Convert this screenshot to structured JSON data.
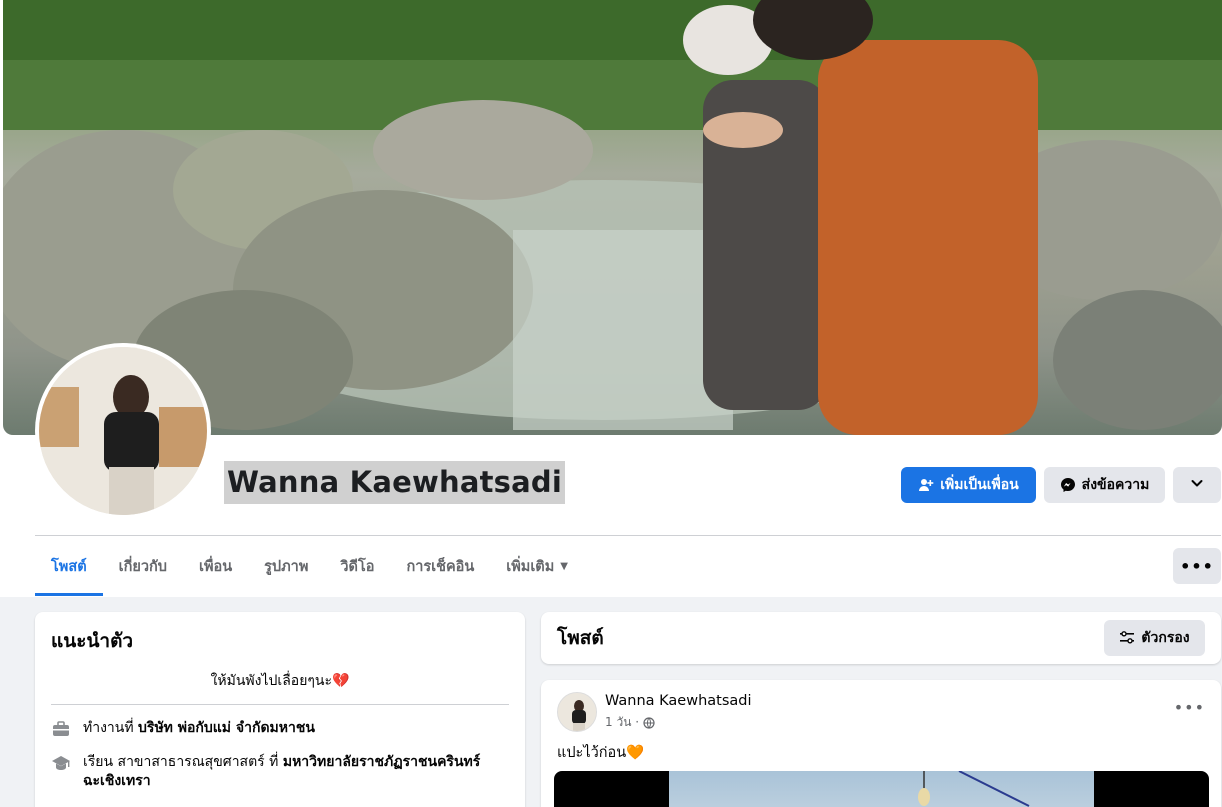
{
  "profile": {
    "name": "Wanna Kaewhatsadi",
    "add_friend_label": "เพิ่มเป็นเพื่อน",
    "message_label": "ส่งข้อความ"
  },
  "tabs": [
    {
      "label": "โพสต์",
      "active": true
    },
    {
      "label": "เกี่ยวกับ"
    },
    {
      "label": "เพื่อน"
    },
    {
      "label": "รูปภาพ"
    },
    {
      "label": "วิดีโอ"
    },
    {
      "label": "การเช็คอิน"
    },
    {
      "label": "เพิ่มเติม"
    }
  ],
  "intro": {
    "title": "แนะนำตัว",
    "bio": "ให้มันพังไปเลื่อยๆนะ💔",
    "work_prefix": "ทำงานที่",
    "work_place": "บริษัท พ่อกับแม่ จำกัดมหาชน",
    "study_prefix": "เรียน สาขาสาธารณสุขศาสตร์ ที่",
    "study_place": "มหาวิทยาลัยราชภัฏราชนครินทร์ ฉะเชิงเทรา"
  },
  "posts_section": {
    "title": "โพสต์",
    "filter_label": "ตัวกรอง"
  },
  "post": {
    "author": "Wanna Kaewhatsadi",
    "time": "1 วัน ·",
    "text": "แปะไว้ก่อน🧡"
  },
  "colors": {
    "accent": "#1b74e4",
    "button_gray": "#e4e6eb",
    "page_bg": "#f0f2f5"
  }
}
